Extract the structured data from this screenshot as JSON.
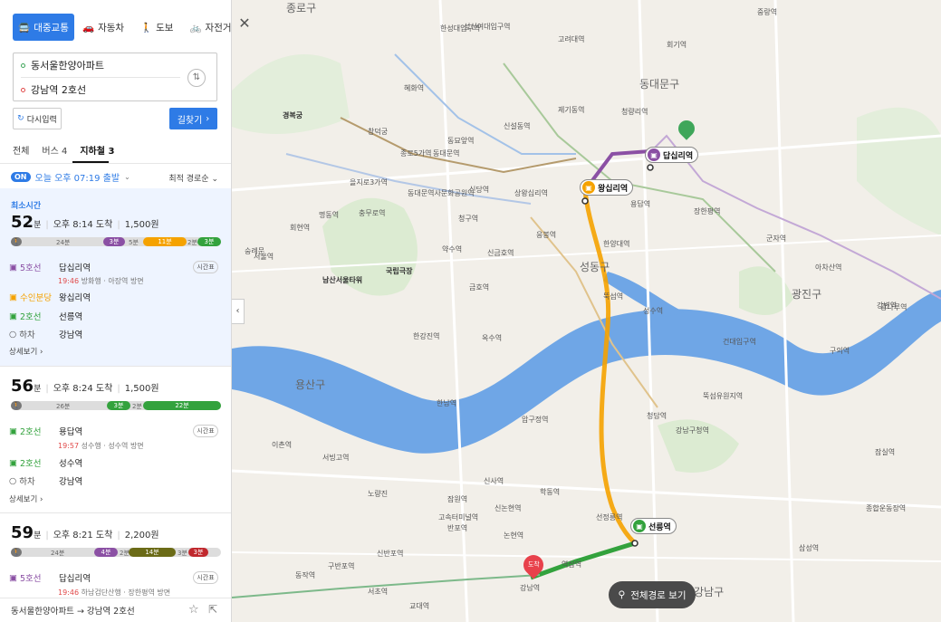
{
  "modes": [
    {
      "label": "대중교통",
      "icon": "bus-icon"
    },
    {
      "label": "자동차",
      "icon": "car-icon"
    },
    {
      "label": "도보",
      "icon": "walk-icon"
    },
    {
      "label": "자전거",
      "icon": "bike-icon"
    }
  ],
  "origin": "동서울한양아파트",
  "destination": "강남역 2호선",
  "reset_label": "다시입력",
  "search_label": "길찾기",
  "tabs": [
    "전체",
    "버스 4",
    "지하철 3"
  ],
  "depart": {
    "badge": "ON",
    "text": "오늘 오후 07:19 출발",
    "sort": "최적 경로순"
  },
  "routes": [
    {
      "tag": "최소시간",
      "minutes": "52",
      "unit": "분",
      "arrive": "오후 8:14 도착",
      "fare": "1,500원",
      "bar": [
        {
          "label": "24분"
        },
        {
          "label": "3분"
        },
        {
          "label": "5분"
        },
        {
          "label": "11분"
        },
        {
          "label": "2분"
        },
        {
          "label": "3분"
        }
      ],
      "steps": [
        {
          "line": "5호선",
          "color": "#8b50a4",
          "station": "답십리역",
          "sub_time": "19:46",
          "sub_text": "방화행 · 아장역 방면",
          "timetable": "시간표"
        },
        {
          "line": "수인분당",
          "color": "#f5a200",
          "station": "왕십리역"
        },
        {
          "line": "2호선",
          "color": "#33a23d",
          "station": "선릉역"
        },
        {
          "line": "하차",
          "color": "#888",
          "station": "강남역"
        }
      ],
      "detail": "상세보기"
    },
    {
      "minutes": "56",
      "unit": "분",
      "arrive": "오후 8:24 도착",
      "fare": "1,500원",
      "bar": [
        {
          "label": "26분"
        },
        {
          "label": "3분"
        },
        {
          "label": "2분"
        },
        {
          "label": "22분"
        }
      ],
      "steps": [
        {
          "line": "2호선",
          "color": "#33a23d",
          "station": "용답역",
          "sub_time": "19:57",
          "sub_text": "성수행 · 성수역 방면",
          "timetable": "시간표"
        },
        {
          "line": "2호선",
          "color": "#33a23d",
          "station": "성수역"
        },
        {
          "line": "하차",
          "color": "#888",
          "station": "강남역"
        }
      ],
      "detail": "상세보기"
    },
    {
      "minutes": "59",
      "unit": "분",
      "arrive": "오후 8:21 도착",
      "fare": "2,200원",
      "bar": [
        {
          "label": "24분"
        },
        {
          "label": "4분"
        },
        {
          "label": "2분"
        },
        {
          "label": "14분"
        },
        {
          "label": "3분"
        },
        {
          "label": "3분"
        }
      ],
      "steps": [
        {
          "line": "5호선",
          "color": "#8b50a4",
          "station": "답십리역",
          "sub_time": "19:46",
          "sub_text": "하남검단산행 · 장한평역 방면",
          "timetable": "시간표"
        }
      ]
    }
  ],
  "footer": "동서울한양아파트 → 강남역 2호선",
  "map": {
    "full_route": "전체경로 보기",
    "arrival": "도착",
    "station_badges": [
      "답십리역",
      "왕십리역",
      "선릉역"
    ],
    "districts": [
      "종로구",
      "동대문구",
      "성동구",
      "광진구",
      "용산구",
      "강남구"
    ],
    "labels": [
      "한성대입구역",
      "성신여대입구역",
      "고려대역",
      "신설동역",
      "제기동역",
      "청량리역",
      "회기역",
      "중랑역",
      "혜화역",
      "종로5가역",
      "동대문역",
      "을지로3가역",
      "충무로역",
      "명동역",
      "회현역",
      "서울역",
      "신당역",
      "상왕십리역",
      "한양대역",
      "뚝섬역",
      "성수역",
      "건대입구역",
      "구의역",
      "강변역",
      "장한평역",
      "군자역",
      "아차산역",
      "광나루역",
      "약수역",
      "금호역",
      "옥수역",
      "압구정역",
      "신사역",
      "잠원역",
      "고속터미널역",
      "반포역",
      "신논현역",
      "강남구청역",
      "선정릉역",
      "삼성역",
      "종합운동장역",
      "잠실역",
      "청담역",
      "학동역",
      "논현역",
      "역삼역",
      "교대역",
      "서초역",
      "뚝섬유원지역",
      "남산서울타워",
      "국립극장",
      "한강진역",
      "이촌역",
      "서빙고역",
      "노량진",
      "구반포역",
      "신반포역",
      "동작역",
      "한남역",
      "청구역",
      "동묘앞역",
      "숭례문",
      "경복궁",
      "창덕궁",
      "동대문역사문화공원역",
      "강남역",
      "응봉역",
      "용답역",
      "신금호역"
    ],
    "colors": {
      "line2": "#33a23d",
      "line5": "#8b50a4",
      "bundang": "#f5a200",
      "accent": "#2e7be6"
    }
  }
}
